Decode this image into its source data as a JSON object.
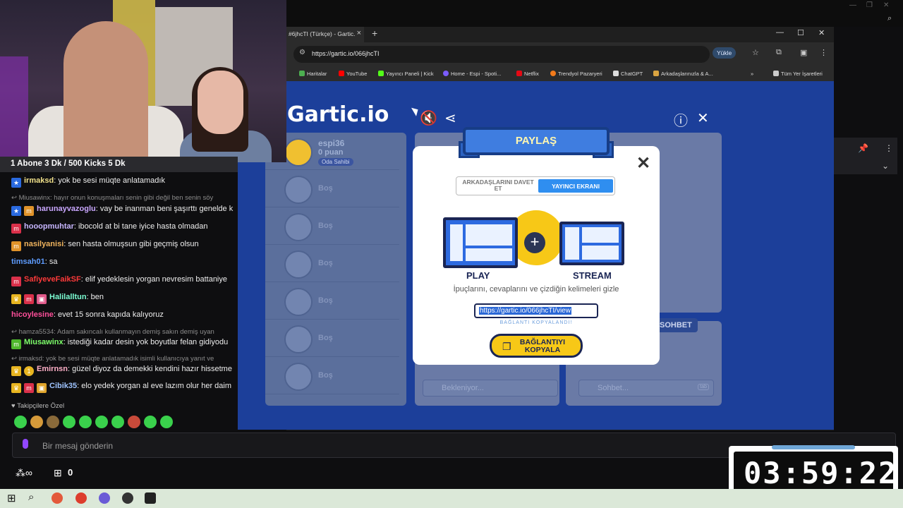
{
  "browser": {
    "tab_title": "#6jhcTI (Türkçe) - Gartic.",
    "url": "https://gartic.io/066jhcTI",
    "install_label": "Yükle",
    "bookmarks": [
      "Haritalar",
      "YouTube",
      "Yayıncı Paneli | Kick",
      "Home - Espi - Spoti...",
      "Netflix",
      "Trendyol Pazaryeri",
      "ChatGPT",
      "Arkadaşlarınızla & A..."
    ],
    "all_bookmarks": "Tüm Yer İşaretleri"
  },
  "game": {
    "logo": "Gartic.io",
    "me": {
      "name": "espi36",
      "points": "0 puan",
      "badge": "Oda Sahibi"
    },
    "empty_slot": "Boş",
    "answer_placeholder": "Bekleniyor...",
    "chat_placeholder": "Sohbet...",
    "chat_key": "tab",
    "chat_tab": "SOHBET"
  },
  "modal": {
    "title": "PAYLAŞ",
    "tab_invite": "ARKADAŞLARINI DAVET ET",
    "tab_stream": "YAYINCI EKRANI",
    "play_label": "PLAY",
    "stream_label": "STREAM",
    "hint": "İpuçlarını, cevaplarını ve çizdiğin kelimeleri gizle",
    "link": "https://gartic.io/066jhcTI/view",
    "copied": "BAĞLANTI KOPYALANDI!",
    "copy_button": "BAĞLANTIYI KOPYALA",
    "colors": {
      "accent": "#2f8ef0",
      "yellow": "#f7c817",
      "navy": "#1a2554"
    }
  },
  "stream": {
    "caption": "1 Abone 3 Dk / 500 Kicks 5 Dk",
    "messages": [
      {
        "user": "irmaksd",
        "text": ": yok be sesi müqte anlatamadık",
        "color": "#f0e08a"
      },
      {
        "reply": "Miusawinx: hayır onun konuşmaları senin gibi değil ben senin söy"
      },
      {
        "user": "harunayvazoglu",
        "text": ": vay be inanman beni şaşırttı genelde k",
        "color": "#c9a7ff"
      },
      {
        "user": "hooopmuhtar",
        "text": ": ibocold at bi tane iyice hasta olmadan",
        "color": "#c7b6ff"
      },
      {
        "user": "nasilyanisi",
        "text": ": sen hasta olmuşsun gibi geçmiş olsun",
        "color": "#f0b45e"
      },
      {
        "user": "timsah01",
        "text": ": sa",
        "color": "#5e9cff"
      },
      {
        "user": "SafiyeveFaikSF",
        "text": ": elif yedeklesin yorgan nevresim battaniye",
        "color": "#ff3a3a"
      },
      {
        "user": "Halilalltun",
        "text": ": ben",
        "color": "#7cffd4"
      },
      {
        "user": "hicoylesine",
        "text": ": evet 15 sonra kapıda kalıyoruz",
        "color": "#ff4f9a"
      },
      {
        "reply": "hamza5534: Adam sakıncalı kullanmayın demiş sakın demiş uyan"
      },
      {
        "user": "Miusawinx",
        "text": ": istediği kadar desin yok boyutlar felan gidiyodu",
        "color": "#7dff6a"
      },
      {
        "reply": "irmaksd: yok be sesi müqte anlatamadık isimli kullanıcıya yanıt ve"
      },
      {
        "user": "Emirnsn",
        "text": ": güzel diyoz da demekki kendini hazır hissetme",
        "color": "#ffb0c8"
      },
      {
        "user": "Cibik35",
        "text": ": elo yedek yorgan al eve lazım olur her daim",
        "color": "#9fc4ff"
      }
    ],
    "subscribers_only": "Takipçilere Özel",
    "send_placeholder": "Bir mesaj gönderin",
    "counter": "0",
    "timer": "03:59:22"
  }
}
